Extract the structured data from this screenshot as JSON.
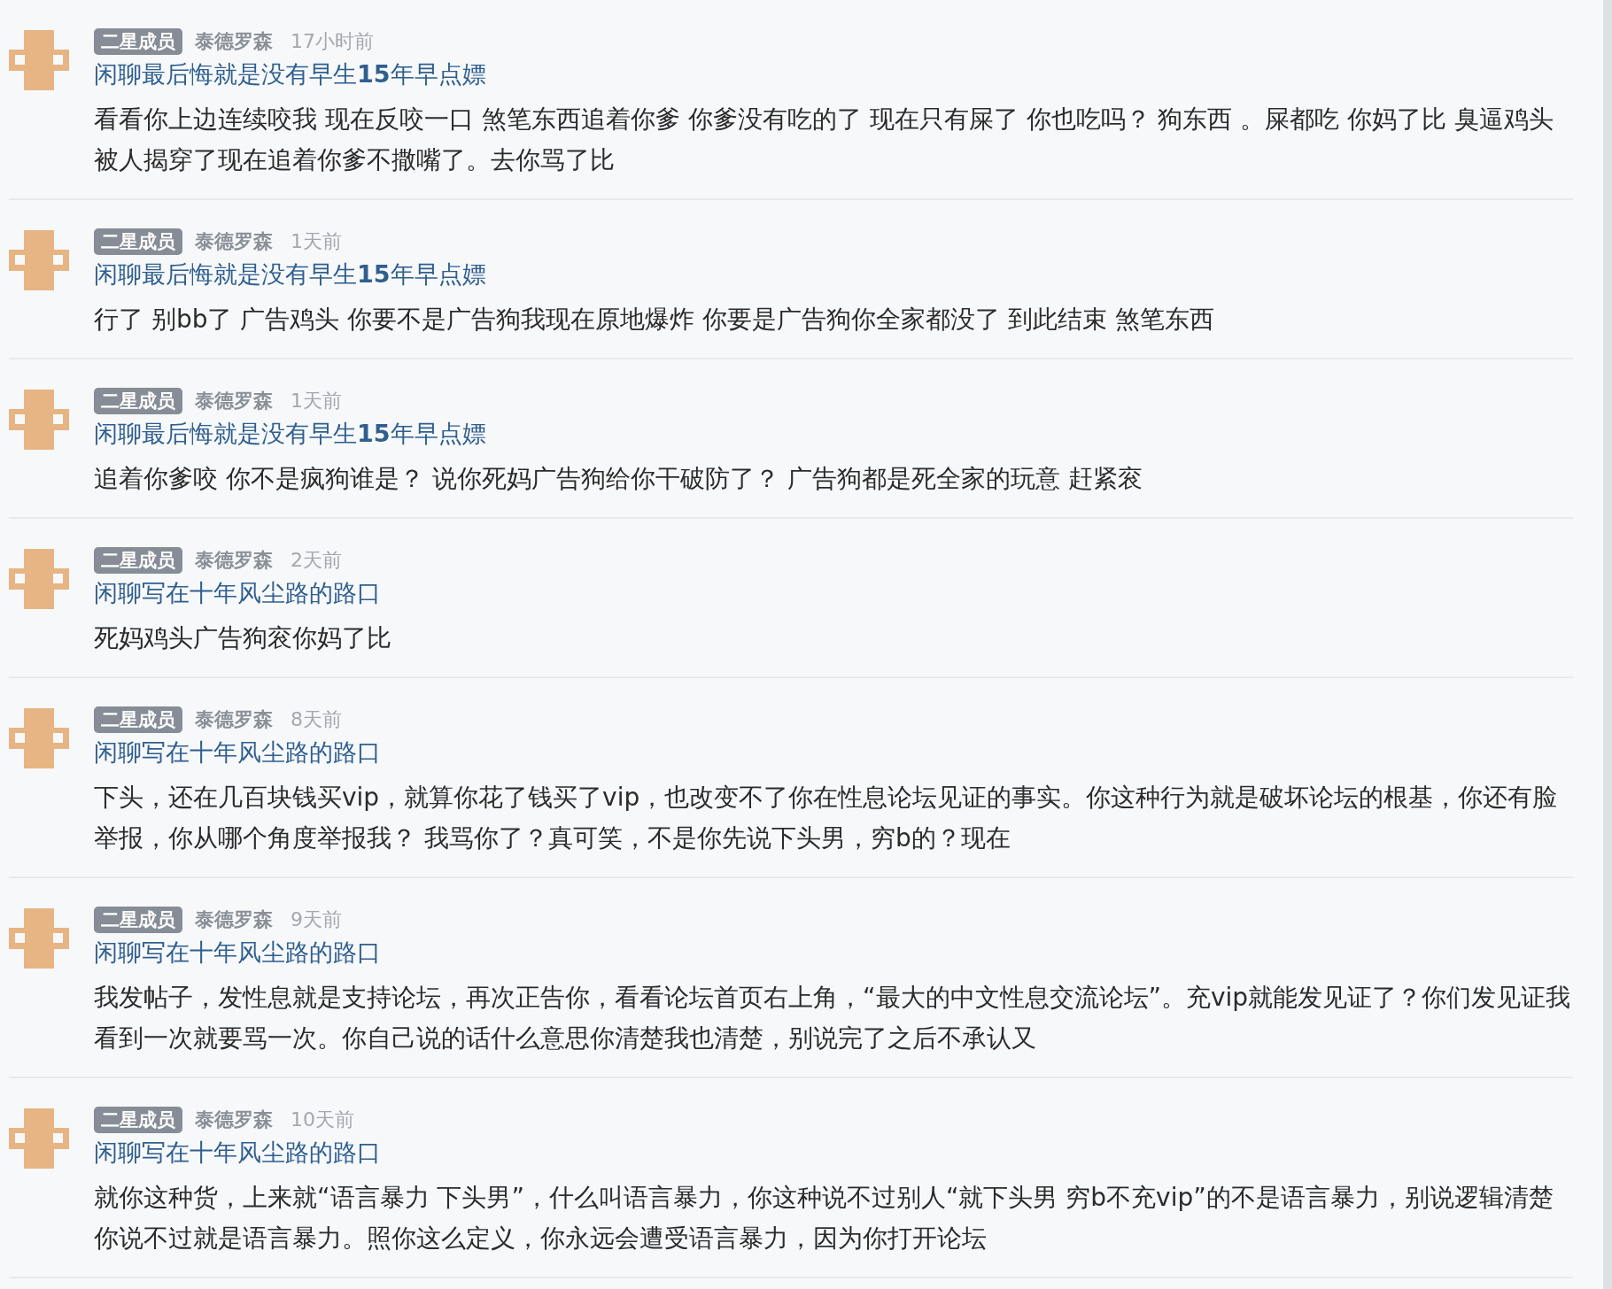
{
  "posts": [
    {
      "badge": "二星成员",
      "author": "泰德罗森",
      "time": "17小时前",
      "title": "闲聊最后悔就是没有早生**15**年早点嫖",
      "body": "看看你上边连续咬我 现在反咬一口 煞笔东西追着你爹 你爹没有吃的了 现在只有屎了 你也吃吗？ 狗东西 。屎都吃 你妈了比 臭逼鸡头被人揭穿了现在追着你爹不撒嘴了。去你骂了比"
    },
    {
      "badge": "二星成员",
      "author": "泰德罗森",
      "time": "1天前",
      "title": "闲聊最后悔就是没有早生**15**年早点嫖",
      "body": "行了 别bb了 广告鸡头 你要不是广告狗我现在原地爆炸 你要是广告狗你全家都没了 到此结束 煞笔东西"
    },
    {
      "badge": "二星成员",
      "author": "泰德罗森",
      "time": "1天前",
      "title": "闲聊最后悔就是没有早生**15**年早点嫖",
      "body": "追着你爹咬 你不是疯狗谁是？ 说你死妈广告狗给你干破防了？ 广告狗都是死全家的玩意 赶紧衮"
    },
    {
      "badge": "二星成员",
      "author": "泰德罗森",
      "time": "2天前",
      "title": "闲聊写在十年风尘路的路口",
      "body": "死妈鸡头广告狗衮你妈了比"
    },
    {
      "badge": "二星成员",
      "author": "泰德罗森",
      "time": "8天前",
      "title": "闲聊写在十年风尘路的路口",
      "body": "下头，还在几百块钱买vip，就算你花了钱买了vip，也改变不了你在性息论坛见证的事实。你这种行为就是破坏论坛的根基，你还有脸举报，你从哪个角度举报我？ 我骂你了？真可笑，不是你先说下头男，穷b的？现在"
    },
    {
      "badge": "二星成员",
      "author": "泰德罗森",
      "time": "9天前",
      "title": "闲聊写在十年风尘路的路口",
      "body": "我发帖子，发性息就是支持论坛，再次正告你，看看论坛首页右上角，“最大的中文性息交流论坛”。充vip就能发见证了？你们发见证我看到一次就要骂一次。你自己说的话什么意思你清楚我也清楚，别说完了之后不承认又"
    },
    {
      "badge": "二星成员",
      "author": "泰德罗森",
      "time": "10天前",
      "title": "闲聊写在十年风尘路的路口",
      "body": "就你这种货，上来就“语言暴力 下头男”，什么叫语言暴力，你这种说不过别人“就下头男 穷b不充vip”的不是语言暴力，别说逻辑清楚你说不过就是语言暴力。照你这么定义，你永远会遭受语言暴力，因为你打开论坛"
    }
  ]
}
